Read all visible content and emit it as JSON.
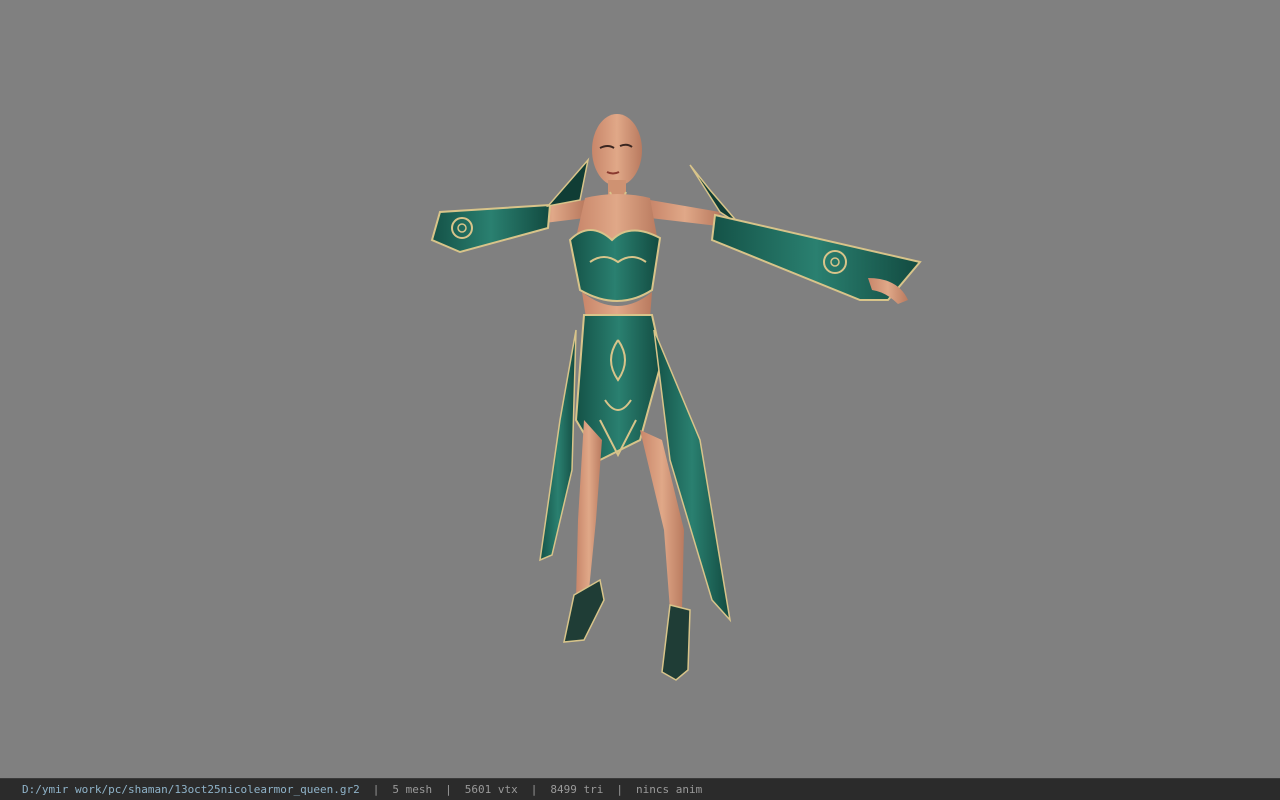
{
  "viewport": {
    "background_color": "#808080",
    "model": "female-character-in-teal-gold-armor"
  },
  "statusbar": {
    "file_path": "D:/ymir work/pc/shaman/13oct25nicolearmor_queen.gr2",
    "mesh_count": "5 mesh",
    "vertex_count": "5601 vtx",
    "triangle_count": "8499 tri",
    "anim_status": "nincs anim",
    "separator": "|"
  },
  "colors": {
    "armor_teal": "#1f6b5e",
    "armor_gold": "#d8c48a",
    "skin": "#d79a76",
    "statusbar_bg": "#2b2b2b"
  }
}
